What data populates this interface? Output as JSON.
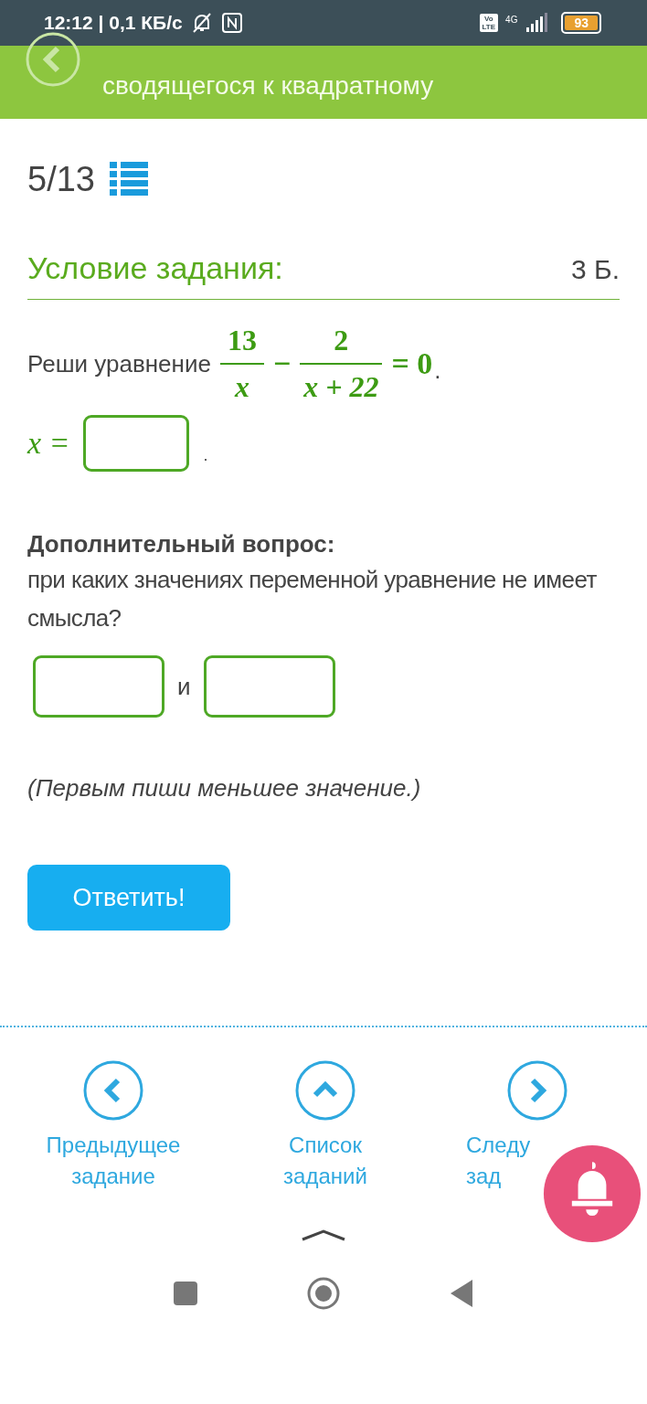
{
  "status_bar": {
    "time_speed": "12:12 | 0,1 КБ/с",
    "volte": [
      "Vo",
      "LTE"
    ],
    "network": "4G",
    "battery": "93"
  },
  "header": {
    "title": "сводящегося к квадратному"
  },
  "progress": {
    "counter": "5/13"
  },
  "task": {
    "heading": "Условие задания:",
    "points": "3 Б.",
    "prompt": "Реши уравнение",
    "frac1": {
      "num": "13",
      "den": "x"
    },
    "operator": "−",
    "frac2": {
      "num": "2",
      "den": "x + 22"
    },
    "rhs": "= 0",
    "end": ".",
    "answer_label": "x =",
    "answer_end": ".",
    "extra_title": "Дополнительный вопрос:",
    "extra_text": "при каких значениях переменной уравнение не имеет смысла?",
    "joiner": "и",
    "note": "(Первым пиши меньшее значение.)",
    "submit": "Ответить!"
  },
  "nav": [
    {
      "kind": "prev",
      "lines": [
        "Предыдущее",
        "задание"
      ]
    },
    {
      "kind": "list",
      "lines": [
        "Список",
        "заданий"
      ]
    },
    {
      "kind": "next",
      "lines": [
        "Следу",
        "зад"
      ]
    }
  ]
}
